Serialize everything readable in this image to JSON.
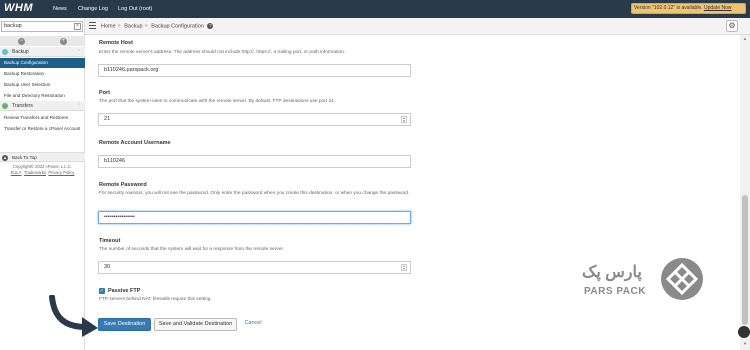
{
  "topbar": {
    "logo": "WHM",
    "nav": [
      "News",
      "Change Log",
      "Log Out (root)"
    ],
    "update_text": "Version \"102.0.12\" is available.",
    "update_link": "Update Now"
  },
  "sidebar": {
    "search_value": "backup",
    "categories": [
      {
        "label": "Backup",
        "icon_color": "#5bc0de"
      },
      {
        "label": "Transfers",
        "icon_color": "#5cb85c"
      }
    ],
    "backup_items": [
      "Backup Configuration",
      "Backup Restoration",
      "Backup User Selection",
      "File and Directory Restoration"
    ],
    "transfer_items": [
      "Review Transfers and Restores",
      "Transfer or Restore a cPanel Account"
    ],
    "back_to_top": "Back To Top",
    "copyright_line": "Copyright© 2022 cPanel, L.L.C.",
    "footer_links": [
      "EULA",
      "Trademarks",
      "Privacy Policy"
    ]
  },
  "breadcrumb": {
    "items": [
      "Home",
      "Backup",
      "Backup Configuration"
    ]
  },
  "form": {
    "remote_host": {
      "label": "Remote Host",
      "help": "Enter the remote server's address. The address should not include http://, https://, a trailing port, or path information.",
      "value": "b110246.parspack.org"
    },
    "port": {
      "label": "Port",
      "help": "The port that the system uses to communicate with the remote server. By default, FTP destinations use port 21.",
      "value": "21"
    },
    "username": {
      "label": "Remote Account Username",
      "value": "b110246"
    },
    "password": {
      "label": "Remote Password",
      "help": "For security reasons, you will not see the password. Only enter the password when you create this destination, or when you change the password.",
      "value": "••••••••••••••••"
    },
    "timeout": {
      "label": "Timeout",
      "help": "The number of seconds that the system will wait for a response from the remote server.",
      "value": "30"
    },
    "passive_ftp": {
      "label": "Passive FTP",
      "help": "FTP servers behind NAT firewalls require this setting.",
      "checked": true
    },
    "buttons": {
      "save": "Save Destination",
      "save_validate": "Save and Validate Destination",
      "cancel": "Cancel"
    }
  },
  "watermark": {
    "line1": "پارس پک",
    "line2": "PARS PACK"
  },
  "colors": {
    "topbar": "#293a4a",
    "primary": "#337ab7",
    "active_nav": "#1d5e8a",
    "update_bg": "#f0c36d"
  }
}
